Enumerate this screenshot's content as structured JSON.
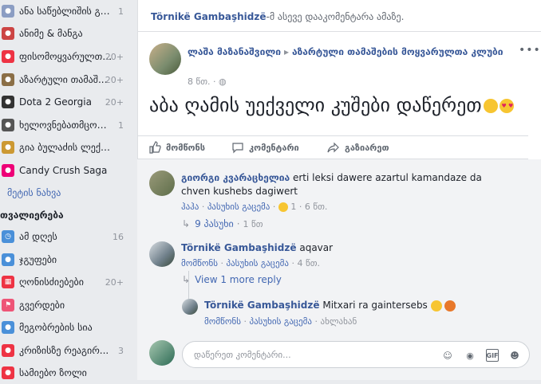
{
  "sidebar": {
    "items": [
      {
        "label": "ანა საწებლიშის გვ...",
        "count": "1",
        "color": "#8b9dc3"
      },
      {
        "label": "ანიმე & მანგა",
        "count": "",
        "color": "#c44"
      },
      {
        "label": "ფისომოყვარულთა...",
        "count": "20+",
        "color": "#e34"
      },
      {
        "label": "აზარტული თამაშ...",
        "count": "20+",
        "color": "#8b6f47"
      },
      {
        "label": "Dota 2 Georgia",
        "count": "20+",
        "color": "#333"
      },
      {
        "label": "ხელოვნებათმცოდ...",
        "count": "1",
        "color": "#555"
      },
      {
        "label": "გია ბულაძის ლექს...",
        "count": "",
        "color": "#c93"
      },
      {
        "label": "Candy Crush Saga",
        "count": "",
        "color": "#e07"
      }
    ],
    "more_label": "მეტის ნახვა",
    "section_title": "თვალიერება",
    "explore": [
      {
        "label": "ამ დღეს",
        "count": "16",
        "color": "#4a90d9"
      },
      {
        "label": "ჯგუფები",
        "count": "",
        "color": "#4a90d9"
      },
      {
        "label": "ღონისძიებები",
        "count": "20+",
        "color": "#e34"
      },
      {
        "label": "გვერდები",
        "count": "",
        "color": "#e57"
      },
      {
        "label": "მეგობრების სია",
        "count": "",
        "color": "#4a90d9"
      },
      {
        "label": "კრიზისზე რეაგირ...",
        "count": "3",
        "color": "#e34"
      },
      {
        "label": "სამიებო ზოლი",
        "count": "",
        "color": "#e34"
      }
    ]
  },
  "notice": {
    "name": "Törnikë Gambaşhidzë",
    "text": "-მ ასევე დააკომენტარა ამაზე."
  },
  "post": {
    "author": "ლაშა მაზანაშვილი",
    "group": "აზარტული თამაშების მოყვარულთა კლუბი",
    "time": "8 წთ.",
    "text": "აბა ღამის უექველი კუშები დაწერეთ",
    "menu": "•••"
  },
  "actions": {
    "like": "მომწონს",
    "comment": "კომენტარი",
    "share": "გაზიარეთ"
  },
  "comments": [
    {
      "name": "გიორგი კვარაცხელია",
      "text": "erti leksi dawere azartul kamandaze da chven kushebs dagiwert",
      "meta_like": "ჰაჰა",
      "meta_reply": "პასუხის გაცემა",
      "reaction_count": "1",
      "time": "6 წთ.",
      "replies_label": "9 პასუხი",
      "replies_time": "1 წთ"
    },
    {
      "name": "Törnikë Gambaşhidzë",
      "text": "aqavar",
      "meta_like": "მომწონს",
      "meta_reply": "პასუხის გაცემა",
      "time": "4 წთ.",
      "view_more": "View 1 more reply"
    },
    {
      "name": "Törnikë Gambaşhidzë",
      "text": "Mitxari ra gaintersebs",
      "meta_like": "მომწონს",
      "meta_reply": "პასუხის გაცემა",
      "time": "ახლახან"
    }
  ],
  "composer": {
    "placeholder": "დაწერეთ კომენტარი..."
  },
  "colors": {
    "link": "#385898",
    "accent": "#4267b2",
    "meta": "#90949c"
  }
}
